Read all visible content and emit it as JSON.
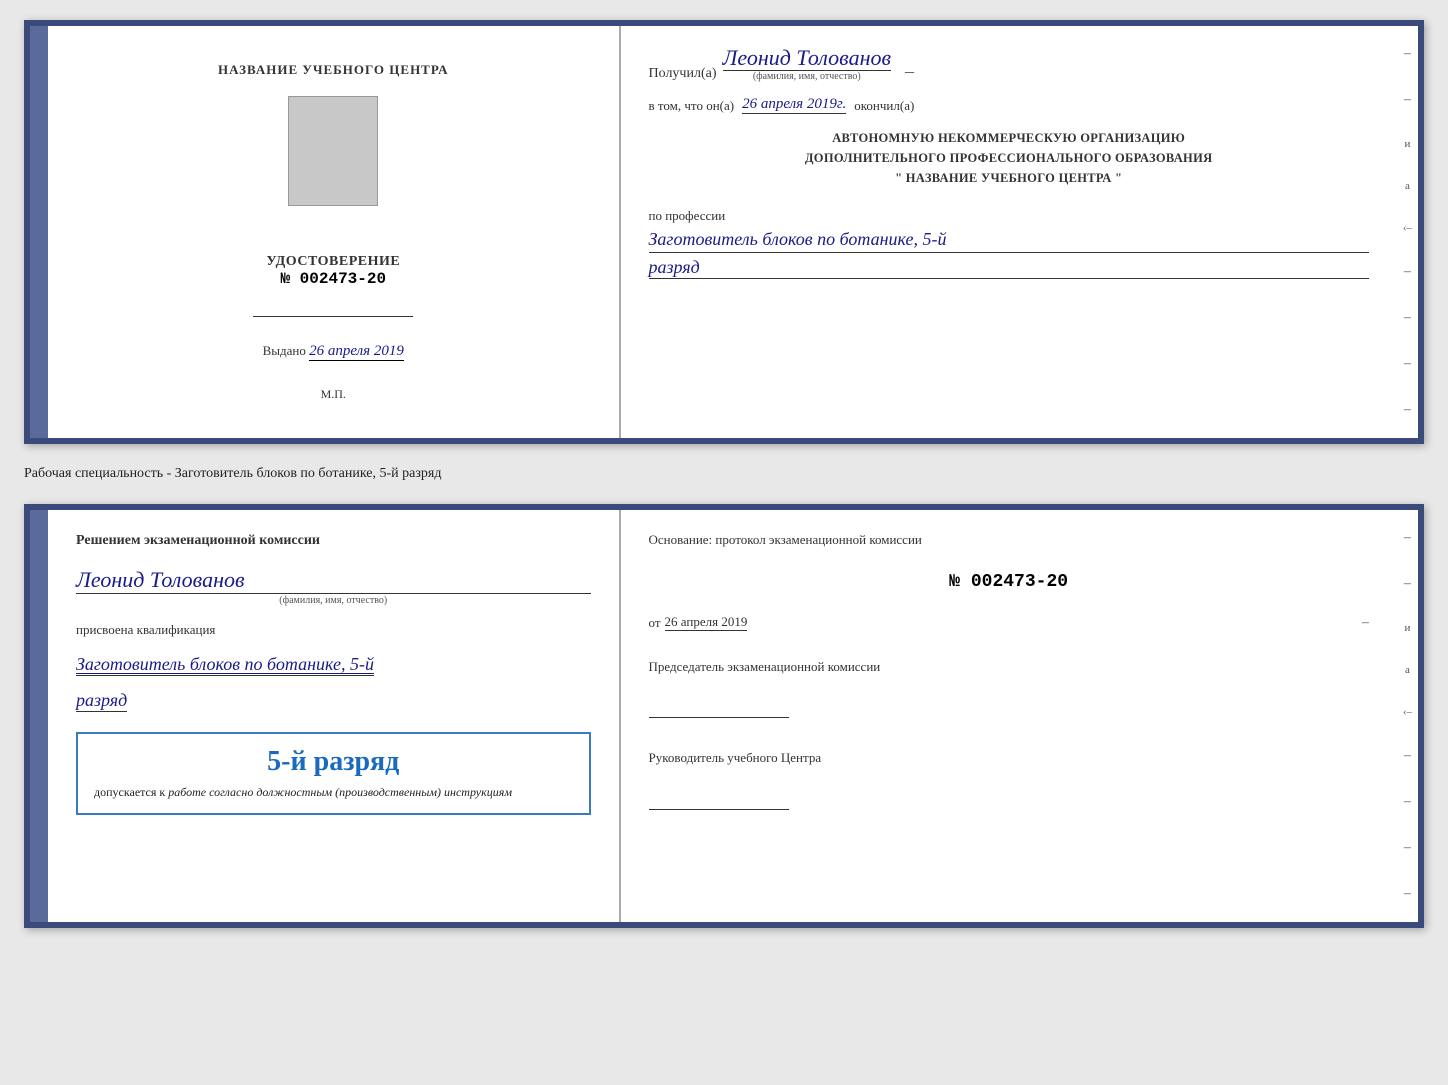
{
  "page": {
    "background": "#e8e8e8"
  },
  "top_document": {
    "left": {
      "training_center_label": "НАЗВАНИЕ УЧЕБНОГО ЦЕНТРА",
      "cert_title": "УДОСТОВЕРЕНИЕ",
      "cert_number_prefix": "№",
      "cert_number": "002473-20",
      "issue_label": "Выдано",
      "issue_date": "26 апреля 2019",
      "mp_label": "М.П."
    },
    "right": {
      "received_prefix": "Получил(а)",
      "recipient_name": "Леонид Толованов",
      "fio_subtitle": "(фамилия, имя, отчество)",
      "date_prefix": "в том, что он(а)",
      "date_handwritten": "26 апреля 2019г.",
      "date_suffix": "окончил(а)",
      "org_line1": "АВТОНОМНУЮ НЕКОММЕРЧЕСКУЮ ОРГАНИЗАЦИЮ",
      "org_line2": "ДОПОЛНИТЕЛЬНОГО ПРОФЕССИОНАЛЬНОГО ОБРАЗОВАНИЯ",
      "org_line3": "\"  НАЗВАНИЕ УЧЕБНОГО ЦЕНТРА  \"",
      "profession_label": "по профессии",
      "profession_name": "Заготовитель блоков по ботанике, 5-й",
      "razryad": "разряд"
    }
  },
  "separator": {
    "text": "Рабочая специальность - Заготовитель блоков по ботанике, 5-й разряд"
  },
  "bottom_document": {
    "left": {
      "commission_title": "Решением экзаменационной комиссии",
      "person_name": "Леонид Толованов",
      "fio_subtitle": "(фамилия, имя, отчество)",
      "qual_label": "присвоена квалификация",
      "qual_name": "Заготовитель блоков по ботанике, 5-й",
      "razryad": "разряд",
      "stamp_grade": "5-й разряд",
      "stamp_prefix": "допускается к",
      "stamp_italic": "работе согласно должностным (производственным) инструкциям"
    },
    "right": {
      "osnov_label": "Основание: протокол экзаменационной комиссии",
      "protocol_number": "№  002473-20",
      "ot_prefix": "от",
      "ot_date": "26 апреля 2019",
      "chairman_label": "Председатель экзаменационной комиссии",
      "director_label": "Руководитель учебного Центра"
    }
  }
}
